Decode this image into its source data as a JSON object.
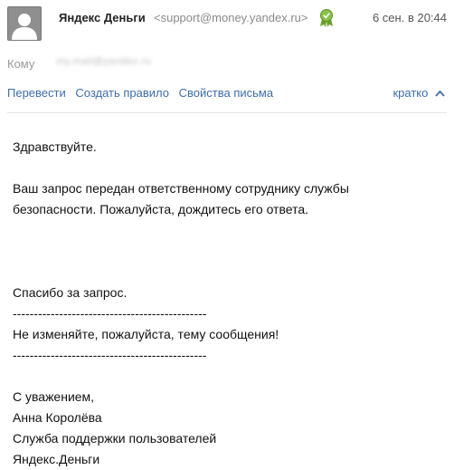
{
  "header": {
    "sender_name": "Яндекс Деньги",
    "sender_email": "<support@money.yandex.ru>",
    "date": "6 сен. в 20:44",
    "verified_icon": "verified-badge-icon",
    "avatar_icon": "user-silhouette-icon"
  },
  "recipient": {
    "label": "Кому",
    "value": "my.mail@yandex.ru"
  },
  "toolbar": {
    "translate": "Перевести",
    "create_rule": "Создать правило",
    "properties": "Свойства письма",
    "brief": "кратко",
    "brief_icon": "chevron-up-icon"
  },
  "message": {
    "greeting": "Здравствуйте.",
    "para1_line1": "Ваш запрос передан ответственному сотруднику службы",
    "para1_line2": "безопасности. Пожалуйста, дождитесь его ответа.",
    "thanks": "Спасибо за запрос.",
    "separator": "----------------------------------------------",
    "notice": "Не изменяйте, пожалуйста, тему сообщения!",
    "regards": "С уважением,",
    "signer": "Анна Королёва",
    "dept": "Служба поддержки пользователей",
    "company": "Яндекс.Деньги"
  },
  "colors": {
    "link": "#3d6dab",
    "muted": "#8a8a8a",
    "verified_green": "#7cb342"
  }
}
